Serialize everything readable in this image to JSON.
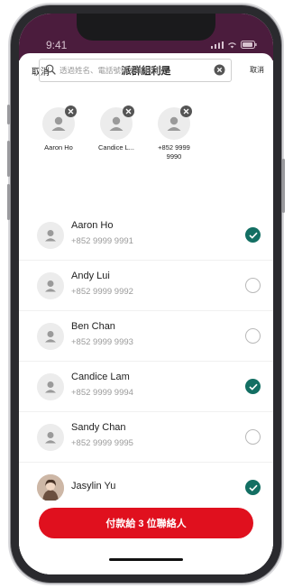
{
  "status_bar": {
    "time": "9:41"
  },
  "nav": {
    "left_label": "取消",
    "title": "派群組利是"
  },
  "search": {
    "placeholder": "透過姓名、電話號碼或電郵付款",
    "cancel_label": "取消"
  },
  "selected": [
    {
      "label": "Aaron Ho"
    },
    {
      "label": "Candice L..."
    },
    {
      "label": "+852 9999 9990"
    }
  ],
  "contacts": [
    {
      "name": "Aaron Ho",
      "phone": "+852 9999 9991",
      "selected": true
    },
    {
      "name": "Andy Lui",
      "phone": "+852 9999 9992",
      "selected": false
    },
    {
      "name": "Ben Chan",
      "phone": "+852 9999 9993",
      "selected": false
    },
    {
      "name": "Candice Lam",
      "phone": "+852 9999 9994",
      "selected": true
    },
    {
      "name": "Sandy Chan",
      "phone": "+852 9999 9995",
      "selected": false
    },
    {
      "name": "Jasylin Yu",
      "phone": "",
      "selected": true
    }
  ],
  "cta": {
    "label": "付款給 3 位聯絡人"
  },
  "colors": {
    "accent_red": "#e0101e",
    "check_green": "#136f63",
    "status_bar_bg": "#4b1c3d"
  }
}
